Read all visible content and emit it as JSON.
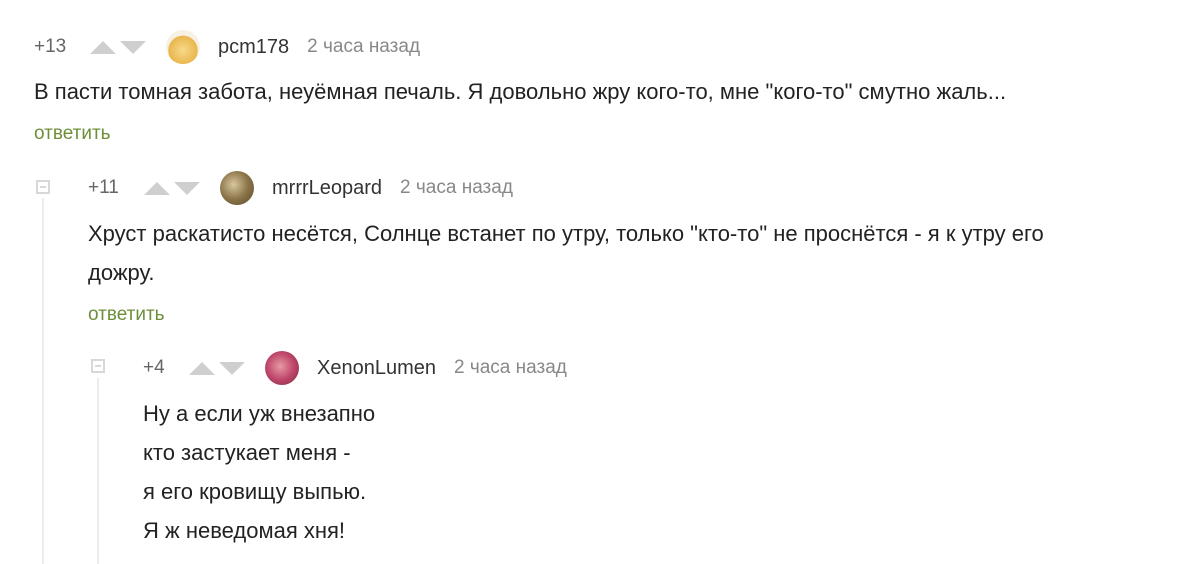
{
  "comments": [
    {
      "rating": "+13",
      "nick": "pcm178",
      "time": "2 часа назад",
      "text_lines": [
        "В пасти томная забота, неуёмная печаль. Я довольно жру кого-то, мне \"кого-то\" смутно жаль..."
      ],
      "reply": "ответить",
      "avatar_color": "#f2c76a"
    },
    {
      "rating": "+11",
      "nick": "mrrrLeopard",
      "time": "2 часа назад",
      "text_lines": [
        "Хруст раскатисто несётся, Солнце встанет по утру, только \"кто-то\" не проснётся - я к утру его",
        "дожру."
      ],
      "reply": "ответить",
      "avatar_color": "#a8926a"
    },
    {
      "rating": "+4",
      "nick": "XenonLumen",
      "time": "2 часа назад",
      "text_lines": [
        "Ну а если уж внезапно",
        "кто застукает меня -",
        "я его кровищу выпью.",
        "Я ж неведомая хня!"
      ],
      "avatar_color": "#c0476b"
    }
  ]
}
